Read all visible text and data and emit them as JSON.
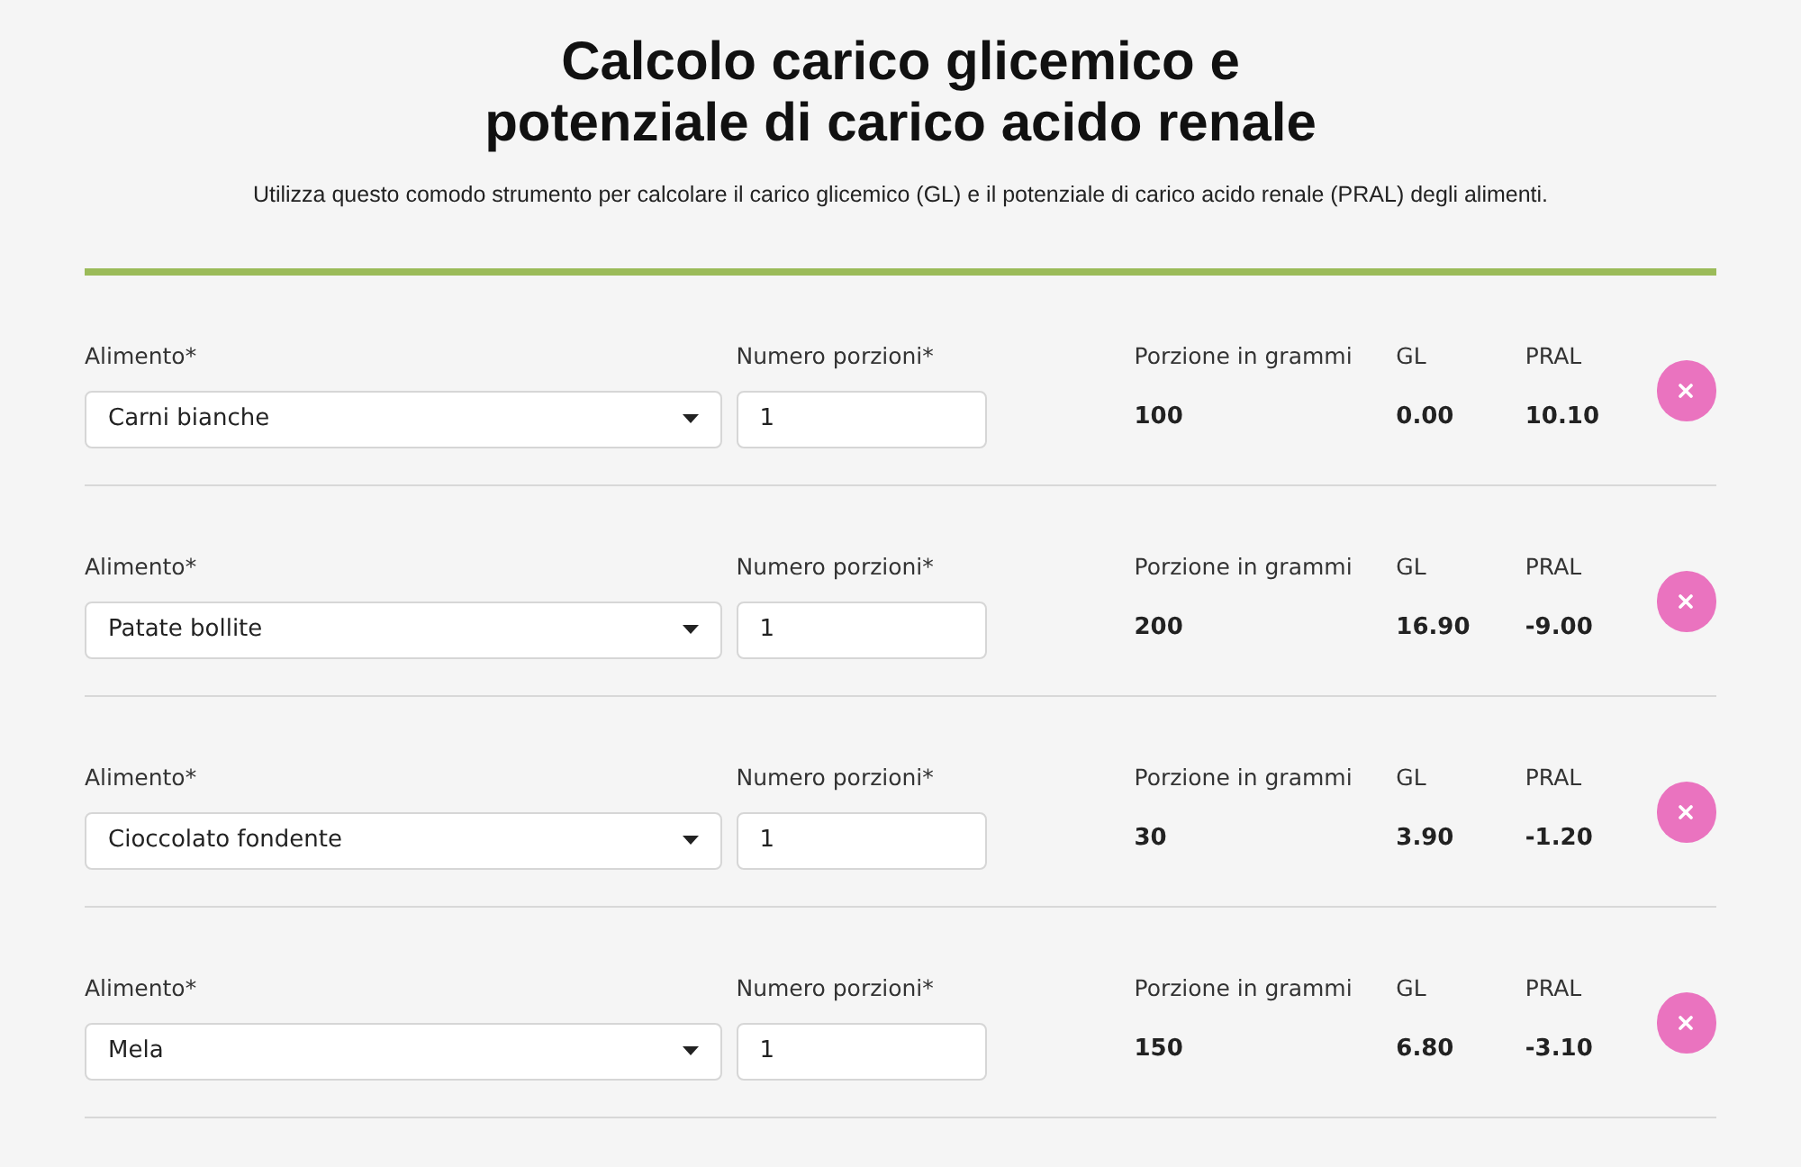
{
  "title_lines": [
    "Calcolo carico glicemico e",
    "potenziale di carico acido renale"
  ],
  "subtitle": "Utilizza questo comodo strumento per calcolare il carico glicemico (GL) e il potenziale di carico acido renale (PRAL) degli alimenti.",
  "rows": [
    {
      "food_label": "Alimento*",
      "food": "Carni bianche",
      "portions_label": "Numero porzioni*",
      "portions": "1",
      "grams_label": "Porzione in grammi",
      "grams": "100",
      "gl_label": "GL",
      "gl": "0.00",
      "pral_label": "PRAL",
      "pral": "10.10"
    },
    {
      "food_label": "Alimento*",
      "food": "Patate bollite",
      "portions_label": "Numero porzioni*",
      "portions": "1",
      "grams_label": "Porzione in grammi",
      "grams": "200",
      "gl_label": "GL",
      "gl": "16.90",
      "pral_label": "PRAL",
      "pral": "-9.00"
    },
    {
      "food_label": "Alimento*",
      "food": "Cioccolato fondente",
      "portions_label": "Numero porzioni*",
      "portions": "1",
      "grams_label": "Porzione in grammi",
      "grams": "30",
      "gl_label": "GL",
      "gl": "3.90",
      "pral_label": "PRAL",
      "pral": "-1.20"
    },
    {
      "food_label": "Alimento*",
      "food": "Mela",
      "portions_label": "Numero porzioni*",
      "portions": "1",
      "grams_label": "Porzione in grammi",
      "grams": "150",
      "gl_label": "GL",
      "gl": "6.80",
      "pral_label": "PRAL",
      "pral": "-3.10"
    }
  ]
}
